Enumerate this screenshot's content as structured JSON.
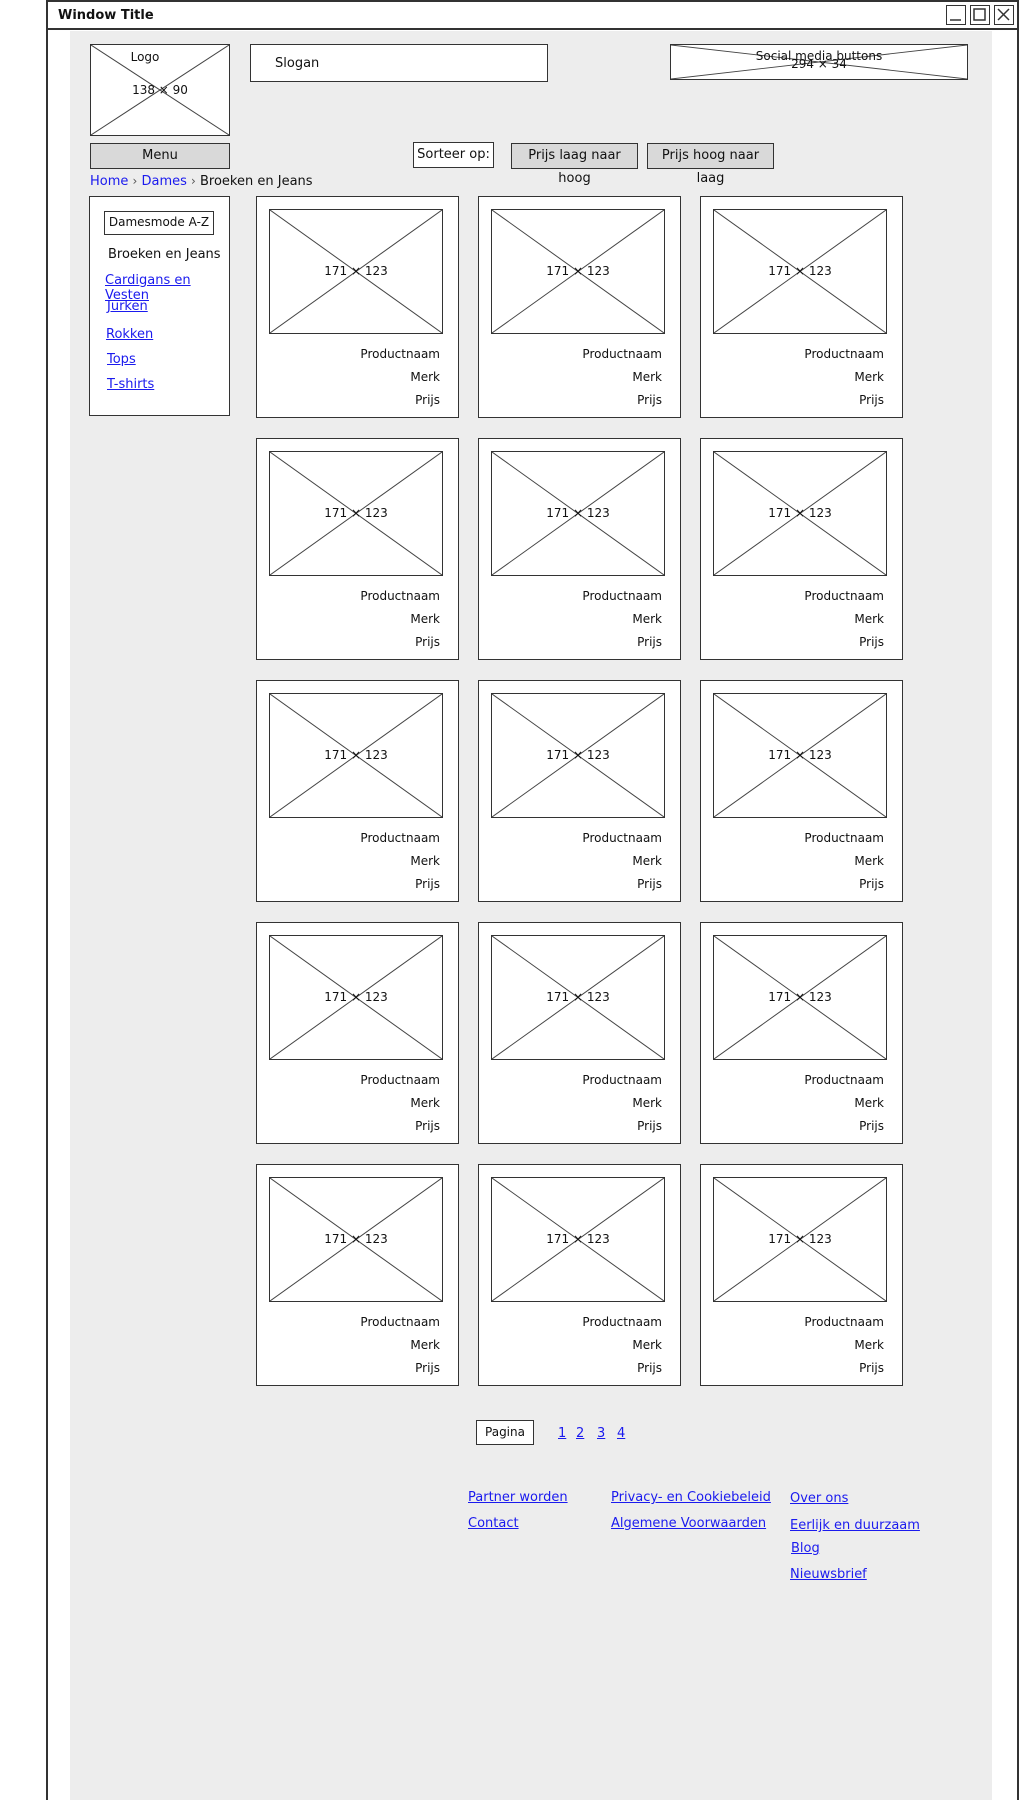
{
  "window": {
    "title": "Window Title"
  },
  "header": {
    "logo_text": "Logo",
    "logo_size": "138 × 90",
    "slogan": "Slogan",
    "social_text": "Social media buttons",
    "social_size": "294 × 34"
  },
  "menu_label": "Menu",
  "sort": {
    "label": "Sorteer op:",
    "asc": "Prijs laag naar hoog",
    "desc": "Prijs hoog naar laag"
  },
  "breadcrumb": [
    "Home",
    "Dames",
    "Broeken en Jeans"
  ],
  "sidebar": {
    "heading": "Damesmode A-Z",
    "current": "Broeken en Jeans",
    "links": [
      "Cardigans en Vesten",
      "Jurken",
      "Rokken",
      "Tops",
      "T-shirts"
    ]
  },
  "product": {
    "image_size": "171 × 123",
    "name": "Productnaam",
    "brand": "Merk",
    "price": "Prijs"
  },
  "pagination": {
    "label": "Pagina",
    "pages": [
      "1",
      "2",
      "3",
      "4"
    ]
  },
  "footer": {
    "col1": [
      "Partner worden",
      "Contact"
    ],
    "col2": [
      "Privacy- en Cookiebeleid",
      "Algemene Voorwaarden"
    ],
    "col3": [
      "Over ons",
      "Eerlijk en duurzaam",
      "Blog",
      "Nieuwsbrief"
    ]
  },
  "colors": {
    "link": "#1a1aee",
    "background": "#ededed",
    "button": "#d9d9d9"
  }
}
